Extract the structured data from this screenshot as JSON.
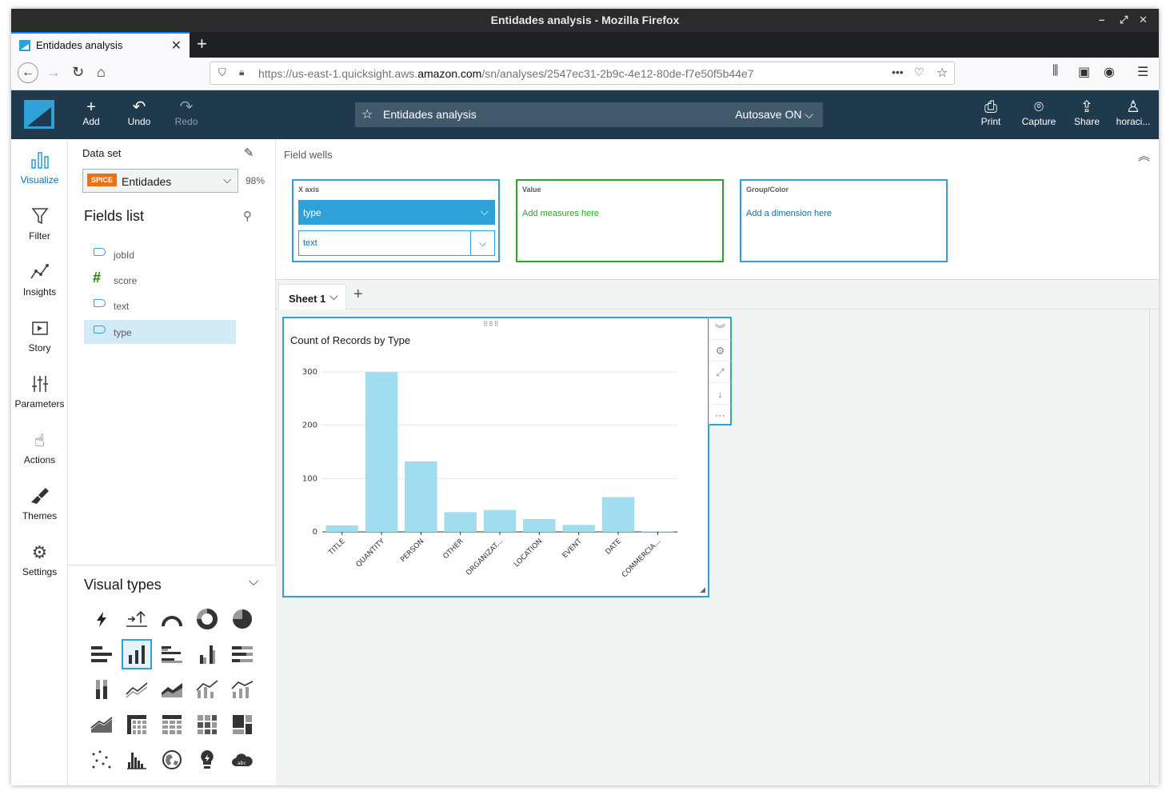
{
  "window": {
    "title": "Entidades analysis - Mozilla Firefox"
  },
  "browser": {
    "tab_title": "Entidades analysis",
    "url_prefix": "https://us-east-1.quicksight.aws.",
    "url_domain": "amazon.com",
    "url_suffix": "/sn/analyses/2547ec31-2b9c-4e12-80de-f7e50f5b44e7"
  },
  "toolbar": {
    "add": "Add",
    "undo": "Undo",
    "redo": "Redo",
    "analysis_name": "Entidades analysis",
    "autosave": "Autosave ON",
    "print": "Print",
    "capture": "Capture",
    "share": "Share",
    "user": "horaci..."
  },
  "leftnav": [
    "Visualize",
    "Filter",
    "Insights",
    "Story",
    "Parameters",
    "Actions",
    "Themes",
    "Settings"
  ],
  "fieldpane": {
    "dataset_label": "Data set",
    "spice": "SPICE",
    "dataset_name": "Entidades",
    "spice_pct": "98%",
    "fields_title": "Fields list",
    "fields": [
      {
        "name": "jobId",
        "kind": "dimension"
      },
      {
        "name": "score",
        "kind": "measure"
      },
      {
        "name": "text",
        "kind": "dimension"
      },
      {
        "name": "type",
        "kind": "dimension"
      }
    ]
  },
  "visual_types_title": "Visual types",
  "field_wells": {
    "title": "Field wells",
    "x_axis_label": "X axis",
    "x_axis_primary": "type",
    "x_axis_secondary": "text",
    "value_label": "Value",
    "value_placeholder": "Add measures here",
    "group_label": "Group/Color",
    "group_placeholder": "Add a dimension here"
  },
  "sheet": {
    "tab": "Sheet 1"
  },
  "colors": {
    "bar": "#a1dcef",
    "accent": "#2ea1d9",
    "header": "#1e3a4c"
  },
  "chart_data": {
    "type": "bar",
    "title": "Count of Records by Type",
    "categories": [
      "TITLE",
      "QUANTITY",
      "PERSON",
      "OTHER",
      "ORGANIZAT...",
      "LOCATION",
      "EVENT",
      "DATE",
      "COMMERCIA..."
    ],
    "values": [
      12,
      300,
      132,
      37,
      41,
      24,
      13,
      65,
      1
    ],
    "ylim": [
      0,
      300
    ],
    "yticks": [
      0,
      100,
      200,
      300
    ],
    "grid": true
  }
}
